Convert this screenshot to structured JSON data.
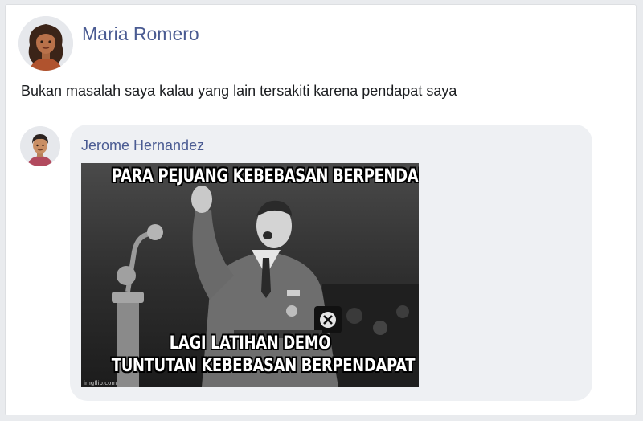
{
  "post": {
    "author_name": "Maria Romero",
    "text": "Bukan masalah saya kalau yang lain tersakiti karena pendapat saya"
  },
  "comment": {
    "author_name": "Jerome Hernandez",
    "meme": {
      "top_caption": "PARA PEJUANG KEBEBASAN BERPENDAPAT",
      "bottom_caption_line1": "LAGI LATIHAN DEMO",
      "bottom_caption_line2": "TUNTUTAN KEBEBASAN BERPENDAPAT",
      "watermark": "imgflip.com"
    }
  },
  "colors": {
    "author_link": "#4a5b92",
    "bubble": "#eef0f3",
    "page_bg": "#e9ebee"
  }
}
